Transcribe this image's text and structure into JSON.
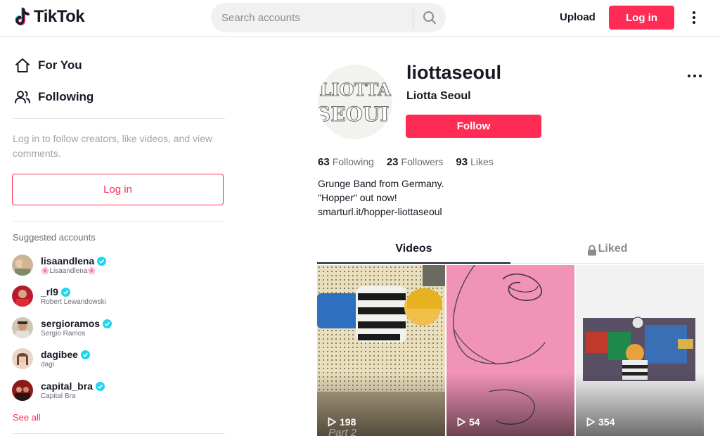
{
  "header": {
    "logo_text": "TikTok",
    "search_placeholder": "Search accounts",
    "upload_label": "Upload",
    "login_label": "Log in"
  },
  "sidebar": {
    "nav": [
      {
        "label": "For You",
        "icon": "home-icon"
      },
      {
        "label": "Following",
        "icon": "people-icon"
      }
    ],
    "login_hint": "Log in to follow creators, like videos, and view comments.",
    "login_label": "Log in",
    "suggested_title": "Suggested accounts",
    "accounts": [
      {
        "username": "lisaandlena",
        "name": "🌸Lisaandlena🌸",
        "verified": true
      },
      {
        "username": "_rl9",
        "name": "Robert Lewandowski",
        "verified": true
      },
      {
        "username": "sergioramos",
        "name": "Sergio Ramos",
        "verified": true
      },
      {
        "username": "dagibee",
        "name": "dagi",
        "verified": true
      },
      {
        "username": "capital_bra",
        "name": "Capital Bra",
        "verified": true
      }
    ],
    "see_all": "See all"
  },
  "profile": {
    "avatar_text_line1": "LIOTTA",
    "avatar_text_line2": "SEOUL",
    "username": "liottaseoul",
    "nickname": "Liotta Seoul",
    "follow_label": "Follow",
    "stats": {
      "following_count": "63",
      "following_label": "Following",
      "followers_count": "23",
      "followers_label": "Followers",
      "likes_count": "93",
      "likes_label": "Likes"
    },
    "bio": [
      "Grunge Band from Germany.",
      "\"Hopper\" out now!",
      "smarturl.it/hopper-liottaseoul"
    ]
  },
  "tabs": {
    "videos": "Videos",
    "liked": "Liked"
  },
  "videos": [
    {
      "views": "198",
      "caption": "Part 2"
    },
    {
      "views": "54"
    },
    {
      "views": "354"
    }
  ],
  "colors": {
    "accent": "#fe2c55",
    "verified": "#20d5ec",
    "text": "#161823",
    "muted": "#8a8b91"
  }
}
